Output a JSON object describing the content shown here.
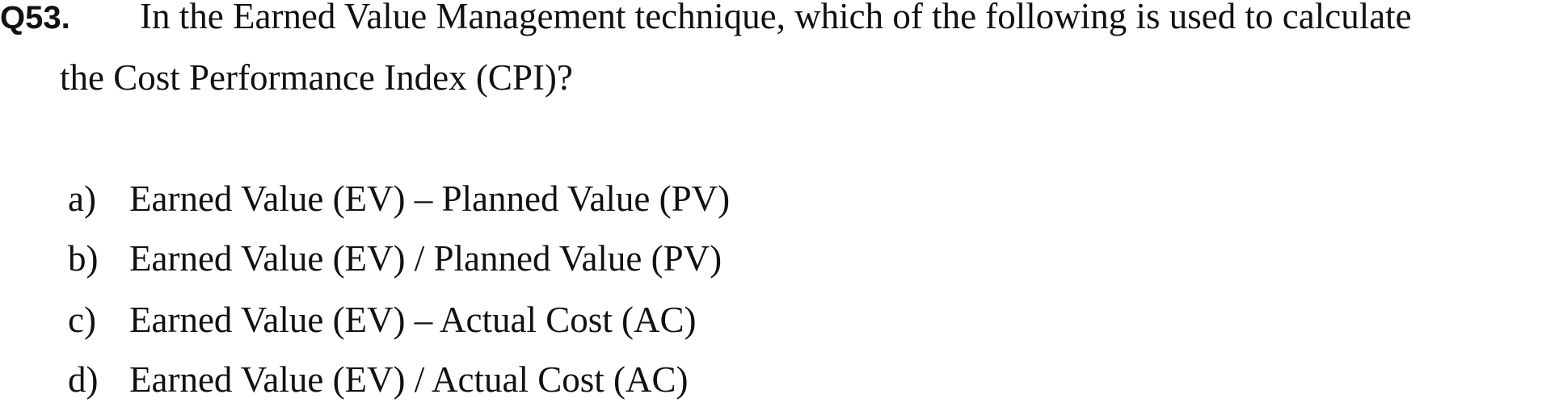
{
  "question": {
    "number": "Q53.",
    "text_line1": "In the Earned Value Management technique, which of the following is used to calculate",
    "text_line2": "the Cost Performance Index (CPI)?"
  },
  "options": [
    {
      "letter": "a)",
      "text": "Earned Value (EV) – Planned Value (PV)"
    },
    {
      "letter": "b)",
      "text": "Earned Value (EV) / Planned Value (PV)"
    },
    {
      "letter": "c)",
      "text": "Earned Value (EV) – Actual Cost (AC)"
    },
    {
      "letter": "d)",
      "text": "Earned Value (EV) / Actual Cost (AC)"
    }
  ]
}
